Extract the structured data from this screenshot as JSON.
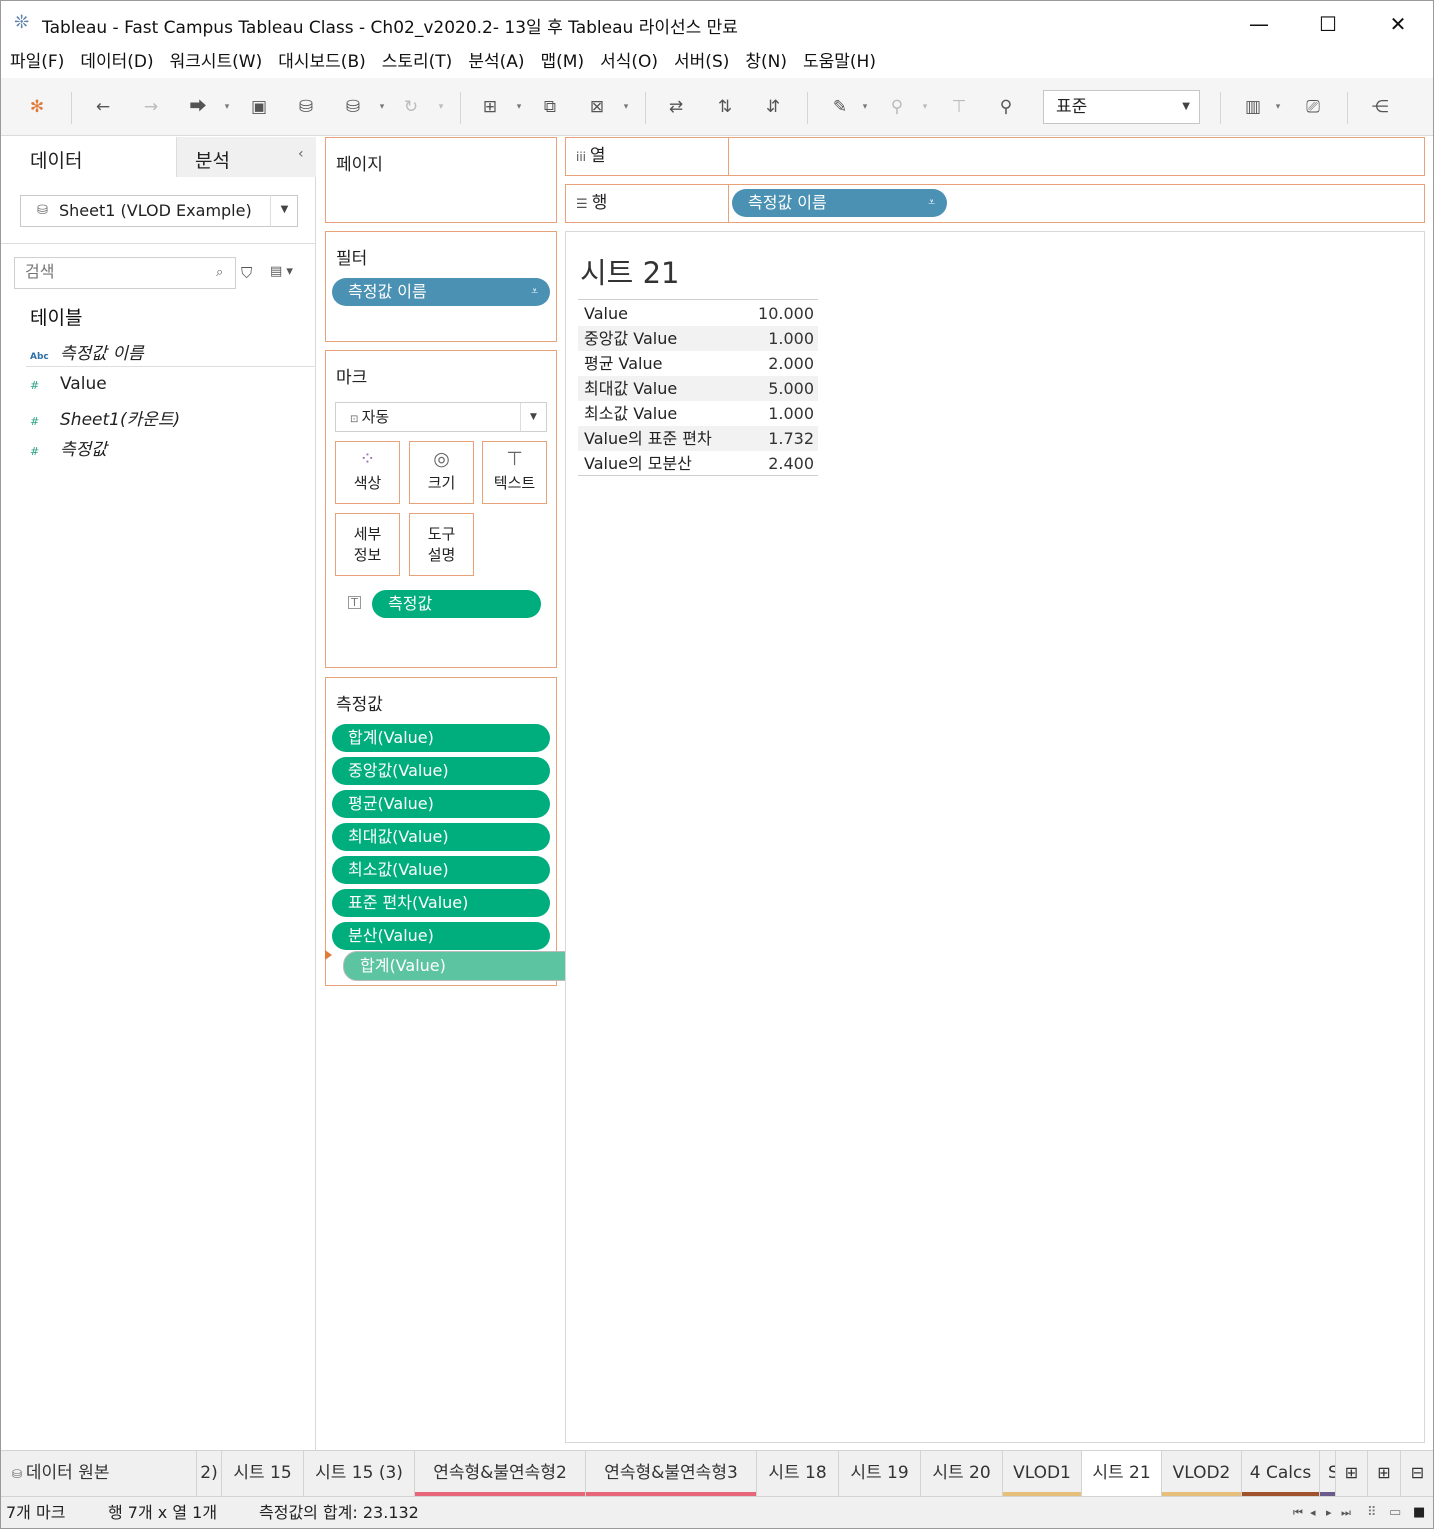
{
  "window": {
    "title": "Tableau - Fast Campus Tableau Class - Ch02_v2020.2- 13일 후 Tableau 라이선스 만료",
    "minimize_symbol": "—",
    "maximize_symbol": "☐",
    "close_symbol": "✕"
  },
  "menu": [
    "파일(F)",
    "데이터(D)",
    "워크시트(W)",
    "대시보드(B)",
    "스토리(T)",
    "분석(A)",
    "맵(M)",
    "서식(O)",
    "서버(S)",
    "창(N)",
    "도움말(H)"
  ],
  "toolbar": {
    "fit_value": "표준"
  },
  "data_pane": {
    "tab_data": "데이터",
    "tab_analysis": "분석",
    "datasource": "Sheet1 (VLOD Example)",
    "search_placeholder": "검색",
    "tables_heading": "테이블",
    "dimension_fields": [
      {
        "name": "측정값 이름",
        "type": "Abc"
      }
    ],
    "measure_fields": [
      {
        "name": "Value",
        "type": "#"
      },
      {
        "name": "Sheet1(카운트)",
        "type": "#"
      },
      {
        "name": "측정값",
        "type": "#"
      }
    ]
  },
  "shelves": {
    "pages_title": "페이지",
    "filters_title": "필터",
    "filters_pill": "측정값 이름",
    "marks_title": "마크",
    "marks_type": "자동",
    "mark_buttons": {
      "color": "색상",
      "size": "크기",
      "text": "텍스트",
      "detail_line1": "세부",
      "detail_line2": "정보",
      "tooltip_line1": "도구",
      "tooltip_line2": "설명"
    },
    "text_pill": "측정값",
    "columns_label": "열",
    "rows_label": "행",
    "rows_pill": "측정값 이름",
    "measure_values_title": "측정값",
    "measure_values": [
      "합계(Value)",
      "중앙값(Value)",
      "평균(Value)",
      "최대값(Value)",
      "최소값(Value)",
      "표준 편차(Value)",
      "분산(Value)"
    ],
    "dragging_pill": "합계(Value)"
  },
  "view": {
    "sheet_title": "시트 21",
    "rows": [
      {
        "name": "Value",
        "value": "10.000"
      },
      {
        "name": "중앙값 Value",
        "value": "1.000"
      },
      {
        "name": "평균 Value",
        "value": "2.000"
      },
      {
        "name": "최대값 Value",
        "value": "5.000"
      },
      {
        "name": "최소값 Value",
        "value": "1.000"
      },
      {
        "name": "Value의 표준 편차",
        "value": "1.732"
      },
      {
        "name": "Value의 모분산",
        "value": "2.400"
      }
    ]
  },
  "sheet_tabs": {
    "datasource_tab": "데이터 원본",
    "tabs": [
      {
        "label": "2)",
        "color": ""
      },
      {
        "label": "시트 15",
        "color": ""
      },
      {
        "label": "시트 15 (3)",
        "color": ""
      },
      {
        "label": "연속형&불연속형2",
        "color": "#e8667a"
      },
      {
        "label": "연속형&불연속형3",
        "color": "#e8667a"
      },
      {
        "label": "시트 18",
        "color": ""
      },
      {
        "label": "시트 19",
        "color": ""
      },
      {
        "label": "시트 20",
        "color": ""
      },
      {
        "label": "VLOD1",
        "color": "#e6c07a"
      },
      {
        "label": "시트 21",
        "color": "",
        "active": true
      },
      {
        "label": "VLOD2",
        "color": "#e6c07a"
      },
      {
        "label": "4 Calcs",
        "color": "#a0522d"
      },
      {
        "label": "S",
        "color": "#6b5b8c"
      }
    ]
  },
  "status": {
    "marks": "7개 마크",
    "rows_cols": "행 7개 x 열 1개",
    "sum": "측정값의 합계: 23.132"
  },
  "colors": {
    "shelf_border": "#e8a27a",
    "dimension_pill": "#4a91b3",
    "measure_pill": "#00ae7d"
  }
}
